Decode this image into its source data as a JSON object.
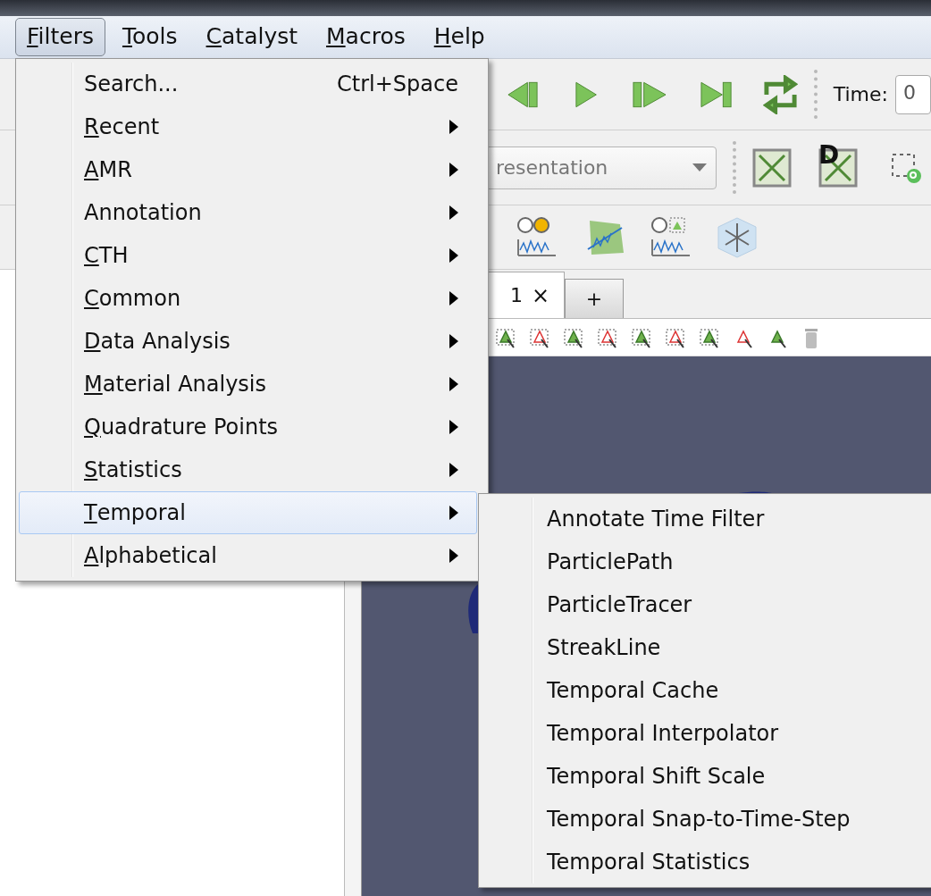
{
  "menubar": [
    {
      "label": "Filters",
      "mnemonic": true,
      "selected": true
    },
    {
      "label": "Tools",
      "mnemonic": true,
      "selected": false
    },
    {
      "label": "Catalyst",
      "mnemonic": true,
      "selected": false
    },
    {
      "label": "Macros",
      "mnemonic": true,
      "selected": false
    },
    {
      "label": "Help",
      "mnemonic": true,
      "selected": false
    }
  ],
  "filters_menu": [
    {
      "label": "Search...",
      "shortcut": "Ctrl+Space",
      "mnemonic": false,
      "submenu": false,
      "selected": false
    },
    {
      "label": "Recent",
      "mnemonic": true,
      "submenu": true,
      "selected": false
    },
    {
      "label": "AMR",
      "mnemonic": true,
      "submenu": true,
      "selected": false
    },
    {
      "label": "Annotation",
      "mnemonic": false,
      "submenu": true,
      "selected": false
    },
    {
      "label": "CTH",
      "mnemonic": true,
      "submenu": true,
      "selected": false
    },
    {
      "label": "Common",
      "mnemonic": true,
      "submenu": true,
      "selected": false
    },
    {
      "label": "Data Analysis",
      "mnemonic": true,
      "submenu": true,
      "selected": false
    },
    {
      "label": "Material Analysis",
      "mnemonic": true,
      "submenu": true,
      "selected": false
    },
    {
      "label": "Quadrature Points",
      "mnemonic": true,
      "submenu": true,
      "selected": false
    },
    {
      "label": "Statistics",
      "mnemonic": true,
      "submenu": true,
      "selected": false
    },
    {
      "label": "Temporal",
      "mnemonic": true,
      "submenu": true,
      "selected": true
    },
    {
      "label": "Alphabetical",
      "mnemonic": true,
      "submenu": true,
      "selected": false
    }
  ],
  "temporal_submenu": [
    "Annotate Time Filter",
    "ParticlePath",
    "ParticleTracer",
    "StreakLine",
    "Temporal Cache",
    "Temporal Interpolator",
    "Temporal Shift Scale",
    "Temporal Snap-to-Time-Step",
    "Temporal Statistics"
  ],
  "toolbar": {
    "time_label": "Time:",
    "time_value": "0",
    "representation": "resentation",
    "camera_badge": "D"
  },
  "view_tabs": [
    {
      "label": "1",
      "close": "×",
      "selected": true
    },
    {
      "label": "+",
      "selected": false
    }
  ]
}
